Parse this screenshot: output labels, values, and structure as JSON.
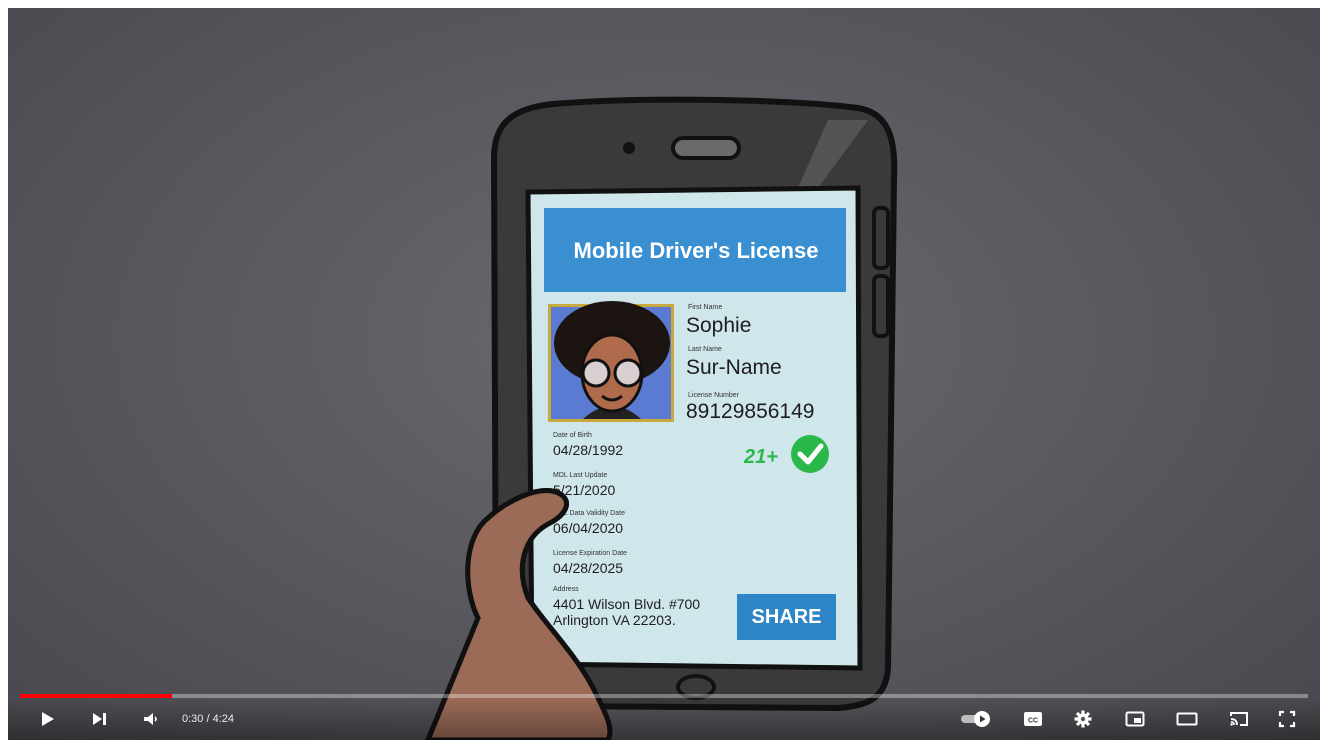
{
  "video": {
    "card_title": "Mobile Driver's License",
    "fields": {
      "first_name_label": "First Name",
      "first_name": "Sophie",
      "last_name_label": "Last Name",
      "last_name": "Sur-Name",
      "license_number_label": "License Number",
      "license_number": "89129856149",
      "dob_label": "Date of Birth",
      "dob": "04/28/1992",
      "mdl_update_label": "MDL Last Update",
      "mdl_update": "5/21/2020",
      "validity_label": "MDL Data Validity Date",
      "validity": "06/04/2020",
      "expiration_label": "License Expiration Date",
      "expiration": "04/28/2025",
      "address_label": "Address",
      "address_line1": "4401 Wilson Blvd. #700",
      "address_line2": "Arlington VA 22203."
    },
    "age_badge": "21+",
    "share_label": "SHARE",
    "colors": {
      "banner": "#3a8fd0",
      "screen": "#cfe6ea",
      "check": "#2bb84a"
    }
  },
  "player": {
    "progress_fraction": 0.118,
    "progress_color": "#ff0000",
    "current_time": "0:30",
    "time_separator": " / ",
    "duration": "4:24",
    "controls": {
      "left": [
        "play-icon",
        "next-icon",
        "volume-icon"
      ],
      "right": [
        "autoplay-toggle-icon",
        "captions-icon",
        "settings-gear-icon",
        "miniplayer-icon",
        "theater-mode-icon",
        "cast-icon",
        "fullscreen-icon"
      ]
    }
  }
}
